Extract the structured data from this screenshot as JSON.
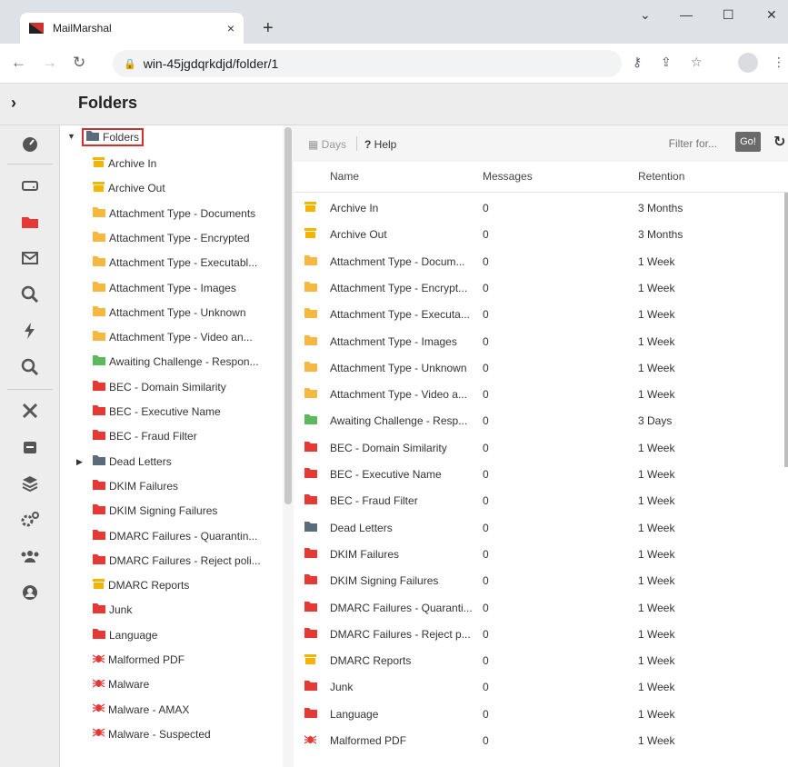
{
  "browser": {
    "tab_title": "MailMarshal",
    "tab_close": "×",
    "new_tab": "+",
    "window_controls": [
      "⌄",
      "—",
      "☐",
      "✕"
    ],
    "url": "win-45jgdqrkdjd/folder/1"
  },
  "header": {
    "toggle": "›",
    "title": "Folders"
  },
  "colors": {
    "yellow": "#f4b400",
    "orange": "#f5b942",
    "green": "#5cb85c",
    "red": "#e53935",
    "slate": "#5a6b7b",
    "highlight_border": "#d32f2f"
  },
  "rail": {
    "icons": [
      "dashboard-icon",
      "drive-icon",
      "folder-icon",
      "mail-icon",
      "search-icon",
      "bolt-icon",
      "search-icon",
      "tools-icon",
      "badge-icon",
      "layers-icon",
      "cogs-icon",
      "users-icon",
      "account-icon"
    ]
  },
  "tree": {
    "root_label": "Folders",
    "items": [
      {
        "label": "Archive In",
        "icon": "archive-icon",
        "color": "#f4b400"
      },
      {
        "label": "Archive Out",
        "icon": "archive-icon",
        "color": "#f4b400"
      },
      {
        "label": "Attachment Type - Documents",
        "icon": "folder-icon",
        "color": "#f5b942"
      },
      {
        "label": "Attachment Type - Encrypted",
        "icon": "folder-icon",
        "color": "#f5b942"
      },
      {
        "label": "Attachment Type - Executabl...",
        "icon": "folder-icon",
        "color": "#f5b942"
      },
      {
        "label": "Attachment Type - Images",
        "icon": "folder-icon",
        "color": "#f5b942"
      },
      {
        "label": "Attachment Type - Unknown",
        "icon": "folder-icon",
        "color": "#f5b942"
      },
      {
        "label": "Attachment Type - Video an...",
        "icon": "folder-icon",
        "color": "#f5b942"
      },
      {
        "label": "Awaiting Challenge - Respon...",
        "icon": "folder-icon",
        "color": "#5cb85c"
      },
      {
        "label": "BEC - Domain Similarity",
        "icon": "folder-icon",
        "color": "#e53935"
      },
      {
        "label": "BEC - Executive Name",
        "icon": "folder-icon",
        "color": "#e53935"
      },
      {
        "label": "BEC - Fraud Filter",
        "icon": "folder-icon",
        "color": "#e53935"
      },
      {
        "label": "Dead Letters",
        "icon": "folder-icon",
        "color": "#5a6b7b",
        "expandable": true
      },
      {
        "label": "DKIM Failures",
        "icon": "folder-icon",
        "color": "#e53935"
      },
      {
        "label": "DKIM Signing Failures",
        "icon": "folder-icon",
        "color": "#e53935"
      },
      {
        "label": "DMARC Failures - Quarantin...",
        "icon": "folder-icon",
        "color": "#e53935"
      },
      {
        "label": "DMARC Failures - Reject poli...",
        "icon": "folder-icon",
        "color": "#e53935"
      },
      {
        "label": "DMARC Reports",
        "icon": "archive-icon",
        "color": "#f4b400"
      },
      {
        "label": "Junk",
        "icon": "folder-icon",
        "color": "#e53935"
      },
      {
        "label": "Language",
        "icon": "folder-icon",
        "color": "#e53935"
      },
      {
        "label": "Malformed PDF",
        "icon": "bug-icon",
        "color": "#e53935"
      },
      {
        "label": "Malware",
        "icon": "bug-icon",
        "color": "#e53935"
      },
      {
        "label": "Malware - AMAX",
        "icon": "bug-icon",
        "color": "#e53935"
      },
      {
        "label": "Malware - Suspected",
        "icon": "bug-icon",
        "color": "#e53935"
      }
    ]
  },
  "toolbar": {
    "days": "Days",
    "help": "Help",
    "filter_placeholder": "Filter for...",
    "go": "Go!"
  },
  "table": {
    "columns": [
      "Name",
      "Messages",
      "Retention"
    ],
    "rows": [
      {
        "name": "Archive In",
        "messages": "0",
        "retention": "3 Months",
        "icon": "archive-icon",
        "color": "#f4b400"
      },
      {
        "name": "Archive Out",
        "messages": "0",
        "retention": "3 Months",
        "icon": "archive-icon",
        "color": "#f4b400"
      },
      {
        "name": "Attachment Type - Docum...",
        "messages": "0",
        "retention": "1 Week",
        "icon": "folder-icon",
        "color": "#f5b942"
      },
      {
        "name": "Attachment Type - Encrypt...",
        "messages": "0",
        "retention": "1 Week",
        "icon": "folder-icon",
        "color": "#f5b942"
      },
      {
        "name": "Attachment Type - Executa...",
        "messages": "0",
        "retention": "1 Week",
        "icon": "folder-icon",
        "color": "#f5b942"
      },
      {
        "name": "Attachment Type - Images",
        "messages": "0",
        "retention": "1 Week",
        "icon": "folder-icon",
        "color": "#f5b942"
      },
      {
        "name": "Attachment Type - Unknown",
        "messages": "0",
        "retention": "1 Week",
        "icon": "folder-icon",
        "color": "#f5b942"
      },
      {
        "name": "Attachment Type - Video a...",
        "messages": "0",
        "retention": "1 Week",
        "icon": "folder-icon",
        "color": "#f5b942"
      },
      {
        "name": "Awaiting Challenge - Resp...",
        "messages": "0",
        "retention": "3 Days",
        "icon": "folder-icon",
        "color": "#5cb85c"
      },
      {
        "name": "BEC - Domain Similarity",
        "messages": "0",
        "retention": "1 Week",
        "icon": "folder-icon",
        "color": "#e53935"
      },
      {
        "name": "BEC - Executive Name",
        "messages": "0",
        "retention": "1 Week",
        "icon": "folder-icon",
        "color": "#e53935"
      },
      {
        "name": "BEC - Fraud Filter",
        "messages": "0",
        "retention": "1 Week",
        "icon": "folder-icon",
        "color": "#e53935"
      },
      {
        "name": "Dead Letters",
        "messages": "0",
        "retention": "1 Week",
        "icon": "folder-icon",
        "color": "#5a6b7b"
      },
      {
        "name": "DKIM Failures",
        "messages": "0",
        "retention": "1 Week",
        "icon": "folder-icon",
        "color": "#e53935"
      },
      {
        "name": "DKIM Signing Failures",
        "messages": "0",
        "retention": "1 Week",
        "icon": "folder-icon",
        "color": "#e53935"
      },
      {
        "name": "DMARC Failures - Quaranti...",
        "messages": "0",
        "retention": "1 Week",
        "icon": "folder-icon",
        "color": "#e53935"
      },
      {
        "name": "DMARC Failures - Reject p...",
        "messages": "0",
        "retention": "1 Week",
        "icon": "folder-icon",
        "color": "#e53935"
      },
      {
        "name": "DMARC Reports",
        "messages": "0",
        "retention": "1 Week",
        "icon": "archive-icon",
        "color": "#f4b400"
      },
      {
        "name": "Junk",
        "messages": "0",
        "retention": "1 Week",
        "icon": "folder-icon",
        "color": "#e53935"
      },
      {
        "name": "Language",
        "messages": "0",
        "retention": "1 Week",
        "icon": "folder-icon",
        "color": "#e53935"
      },
      {
        "name": "Malformed PDF",
        "messages": "0",
        "retention": "1 Week",
        "icon": "bug-icon",
        "color": "#e53935"
      }
    ]
  }
}
